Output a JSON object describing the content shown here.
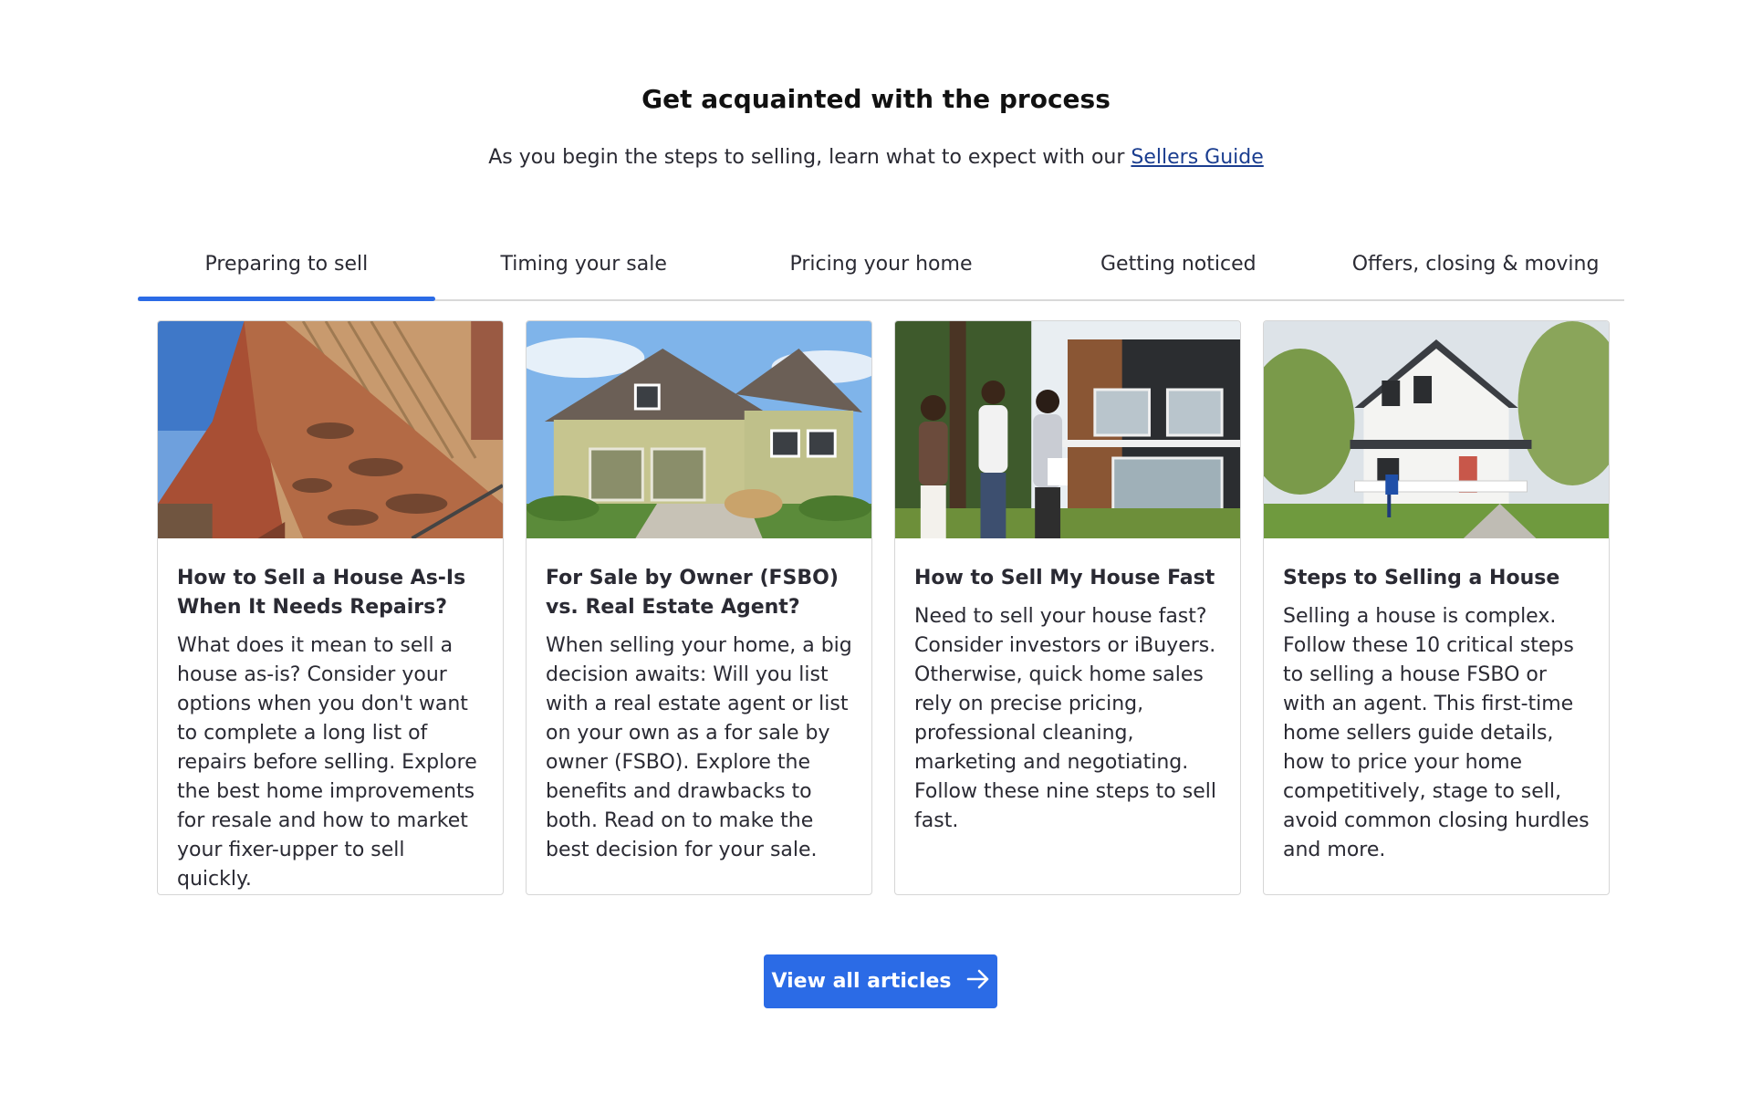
{
  "section": {
    "heading": "Get acquainted with the process",
    "intro_text": "As you begin the steps to selling, learn what to expect with our ",
    "intro_link": "Sellers Guide"
  },
  "tabs": [
    {
      "label": "Preparing to sell",
      "active": true
    },
    {
      "label": "Timing your sale",
      "active": false
    },
    {
      "label": "Pricing your home",
      "active": false
    },
    {
      "label": "Getting noticed",
      "active": false
    },
    {
      "label": "Offers, closing & moving",
      "active": false
    }
  ],
  "cards": [
    {
      "title": "How to Sell a House As-Is When It Needs Repairs?",
      "description": "What does it mean to sell a house as-is? Consider your options when you don't want to complete a long list of repairs before selling. Explore the best home improvements for resale and how to market your fixer-upper to sell quickly.",
      "image": "damaged-roof-photo"
    },
    {
      "title": "For Sale by Owner (FSBO) vs. Real Estate Agent?",
      "description": "When selling your home, a big decision awaits: Will you list with a real estate agent or list on your own as a for sale by owner (FSBO). Explore the benefits and drawbacks to both. Read on to make the best decision for your sale.",
      "image": "suburban-house-photo"
    },
    {
      "title": "How to Sell My House Fast",
      "description": "Need to sell your house fast? Consider investors or iBuyers. Otherwise, quick home sales rely on precise pricing, professional cleaning, marketing and negotiating. Follow these nine steps to sell fast.",
      "image": "handshake-modern-house-photo"
    },
    {
      "title": "Steps to Selling a House",
      "description": "Selling a house is complex. Follow these 10 critical steps to selling a house FSBO or with an agent. This first-time home sellers guide details, how to price your home competitively, stage to sell, avoid common closing hurdles and more.",
      "image": "white-farmhouse-photo"
    }
  ],
  "cta": {
    "label": "View all articles",
    "icon": "arrow-right-icon"
  },
  "colors": {
    "accent": "#2b6be6",
    "link": "#1a3d8f",
    "text": "#2a2a33"
  }
}
